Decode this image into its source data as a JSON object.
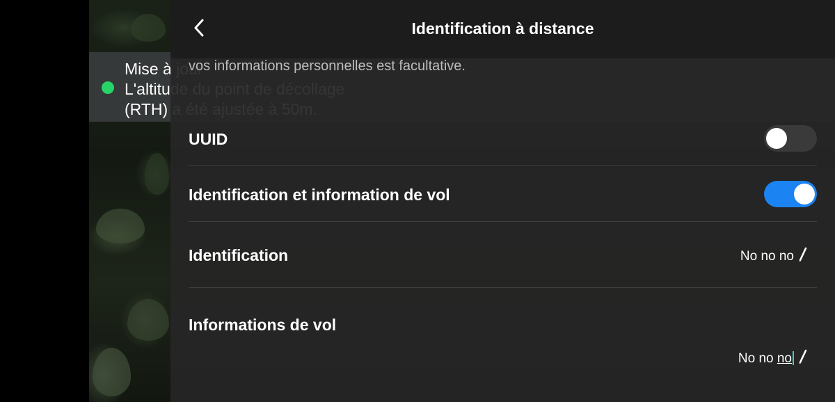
{
  "notification": {
    "lines": "Mise à jour\nL'altitude du point de décollage\n(RTH) a été ajustée à 50m."
  },
  "header": {
    "title": "Identification à distance",
    "back_icon": "chevron-left-icon"
  },
  "intro_text": "vos informations personnelles est facultative.",
  "settings": {
    "uuid": {
      "label": "UUID",
      "enabled": false
    },
    "flight_id": {
      "label": "Identification et information de vol",
      "enabled": true
    },
    "identification": {
      "label": "Identification",
      "value": "No no no",
      "icon": "pencil-icon"
    },
    "flight_info": {
      "label": "Informations de vol",
      "value_prefix": "No no ",
      "value_underlined": "no",
      "icon": "pencil-icon"
    }
  },
  "colors": {
    "toggle_on": "#1c84f2",
    "toggle_off": "#3a3a3a",
    "status_dot": "#27d468"
  }
}
